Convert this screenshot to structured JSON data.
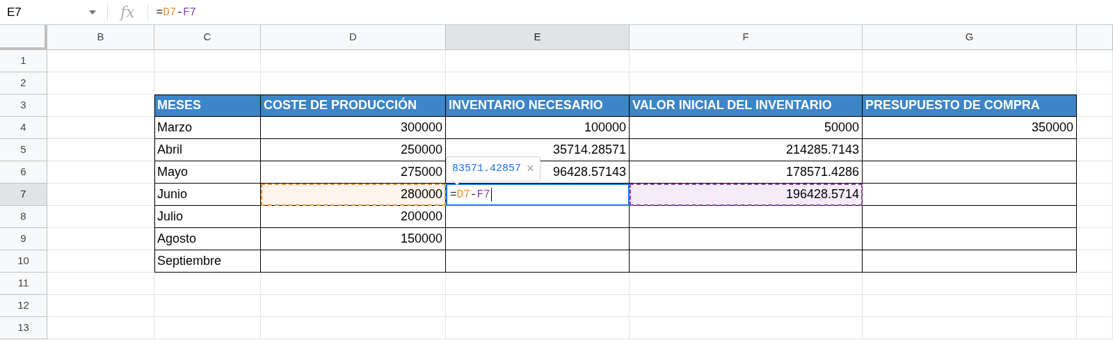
{
  "formula_bar": {
    "cell_ref": "E7",
    "fx": "fx",
    "formula": [
      {
        "text": "=",
        "color": "#202124"
      },
      {
        "text": "D7",
        "color": "#e69138"
      },
      {
        "text": "-",
        "color": "#202124"
      },
      {
        "text": "F7",
        "color": "#8e44ad"
      }
    ]
  },
  "grid": {
    "columns": [
      {
        "label": "B",
        "selected": false
      },
      {
        "label": "C",
        "selected": false
      },
      {
        "label": "D",
        "selected": false
      },
      {
        "label": "E",
        "selected": true
      },
      {
        "label": "F",
        "selected": false
      },
      {
        "label": "G",
        "selected": false
      }
    ],
    "rows": [
      {
        "label": "1",
        "selected": false,
        "cells": [
          null,
          null,
          null,
          null,
          null,
          null
        ]
      },
      {
        "label": "2",
        "selected": false,
        "cells": [
          null,
          null,
          null,
          null,
          null,
          null
        ]
      },
      {
        "label": "3",
        "selected": false,
        "cells": [
          null,
          {
            "kind": "header",
            "text": "MESES"
          },
          {
            "kind": "header",
            "text": "COSTE DE PRODUCCIÓN"
          },
          {
            "kind": "header",
            "text": "INVENTARIO NECESARIO"
          },
          {
            "kind": "header",
            "text": "VALOR INICIAL DEL INVENTARIO"
          },
          {
            "kind": "header",
            "text": "PRESUPUESTO DE COMPRA"
          }
        ]
      },
      {
        "label": "4",
        "selected": false,
        "cells": [
          null,
          {
            "kind": "label",
            "text": "Marzo"
          },
          {
            "kind": "number",
            "text": "300000"
          },
          {
            "kind": "number",
            "text": "100000"
          },
          {
            "kind": "number",
            "text": "50000"
          },
          {
            "kind": "number",
            "text": "350000"
          }
        ]
      },
      {
        "label": "5",
        "selected": false,
        "cells": [
          null,
          {
            "kind": "label",
            "text": "Abril"
          },
          {
            "kind": "number",
            "text": "250000"
          },
          {
            "kind": "number",
            "text": "35714.28571"
          },
          {
            "kind": "number",
            "text": "214285.7143"
          },
          {
            "kind": "blank"
          }
        ]
      },
      {
        "label": "6",
        "selected": false,
        "cells": [
          null,
          {
            "kind": "label",
            "text": "Mayo"
          },
          {
            "kind": "number",
            "text": "275000"
          },
          {
            "kind": "number",
            "text": "96428.57143"
          },
          {
            "kind": "number",
            "text": "178571.4286"
          },
          {
            "kind": "blank"
          }
        ]
      },
      {
        "label": "7",
        "selected": true,
        "cells": [
          null,
          {
            "kind": "label",
            "text": "Junio"
          },
          {
            "kind": "number",
            "text": "280000",
            "color": "#e69138"
          },
          {
            "kind": "editor",
            "formula": [
              {
                "text": "=",
                "color": "#202124"
              },
              {
                "text": "D7",
                "color": "#e69138"
              },
              {
                "text": "-",
                "color": "#202124"
              },
              {
                "text": "F7",
                "color": "#8e44ad"
              }
            ],
            "tooltip": {
              "value": "83571.42857",
              "close": "×"
            }
          },
          {
            "kind": "number",
            "text": "196428.5714",
            "color": "#8e44ad"
          },
          {
            "kind": "blank"
          }
        ]
      },
      {
        "label": "8",
        "selected": false,
        "cells": [
          null,
          {
            "kind": "label",
            "text": "Julio"
          },
          {
            "kind": "number",
            "text": "200000"
          },
          {
            "kind": "blank"
          },
          {
            "kind": "blank"
          },
          {
            "kind": "blank"
          }
        ]
      },
      {
        "label": "9",
        "selected": false,
        "cells": [
          null,
          {
            "kind": "label",
            "text": "Agosto"
          },
          {
            "kind": "number",
            "text": "150000"
          },
          {
            "kind": "blank"
          },
          {
            "kind": "blank"
          },
          {
            "kind": "blank"
          }
        ]
      },
      {
        "label": "10",
        "selected": false,
        "cells": [
          null,
          {
            "kind": "label",
            "text": "Septiembre"
          },
          {
            "kind": "blank"
          },
          {
            "kind": "blank"
          },
          {
            "kind": "blank"
          },
          {
            "kind": "blank"
          }
        ]
      },
      {
        "label": "11",
        "selected": false,
        "cells": [
          null,
          null,
          null,
          null,
          null,
          null
        ]
      },
      {
        "label": "12",
        "selected": false,
        "cells": [
          null,
          null,
          null,
          null,
          null,
          null
        ]
      },
      {
        "label": "13",
        "selected": false,
        "cells": [
          null,
          null,
          null,
          null,
          null,
          null
        ]
      }
    ]
  }
}
